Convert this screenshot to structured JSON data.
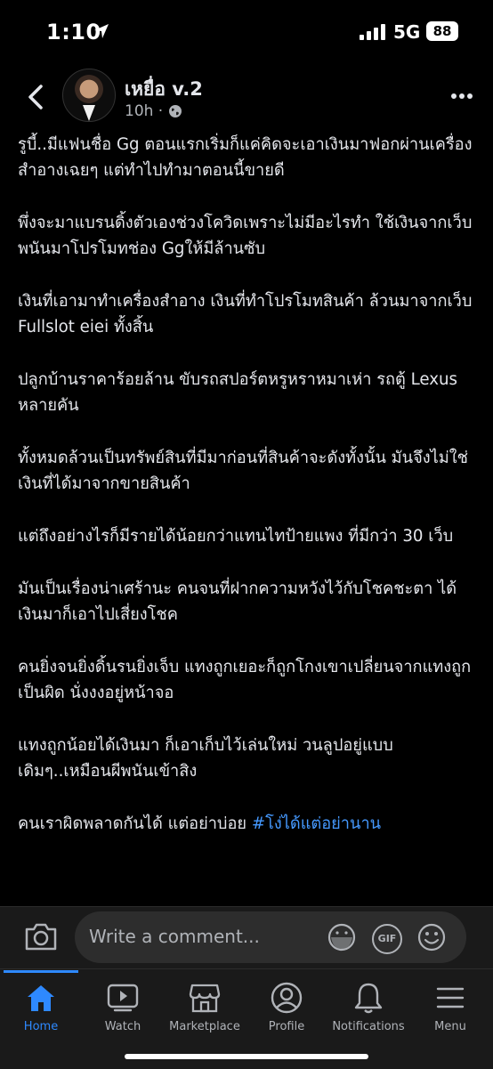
{
  "status": {
    "time": "1:10",
    "network": "5G",
    "battery": "88"
  },
  "post": {
    "author": "เหยื่อ v.2",
    "time": "10h ·",
    "paragraphs": [
      "รูบี้..มีแฟนชื่อ Gg ตอนแรกเริ่มก็แค่คิดจะเอาเงินมาฟอกผ่านเครื่องสำอางเฉยๆ แต่ทำไปทำมาตอนนี้ขายดี",
      "พึ่งจะมาแบรนดิ้งตัวเองช่วงโควิดเพราะไม่มีอะไรทำ ใช้เงินจากเว็บพนันมาโปรโมทช่อง Ggให้มีล้านซับ",
      "เงินที่เอามาทำเครื่องสำอาง เงินที่ทำโปรโมทสินค้า ล้วนมาจากเว็บ Fullslot eiei ทั้งสิ้น",
      "ปลูกบ้านราคาร้อยล้าน ขับรถสปอร์ตหรูหราหมาเห่า รถตู้ Lexus หลายคัน",
      "ทั้งหมดล้วนเป็นทรัพย์สินที่มีมาก่อนที่สินค้าจะดังทั้งนั้น มันจึงไม่ใช่เงินที่ได้มาจากขายสินค้า",
      "แต่ถึงอย่างไรก็มีรายได้น้อยกว่าแทนไทป้ายแพง ที่มีกว่า 30 เว็บ",
      "มันเป็นเรื่องน่าเศร้านะ คนจนที่ฝากความหวังไว้กับโชคชะตา ได้เงินมาก็เอาไปเสี่ยงโชค",
      "คนยิ่งจนยิ่งดิ้นรนยิ่งเจ็บ แทงถูกเยอะก็ถูกโกงเขาเปลี่ยนจากแทงถูกเป็นผิด นั่งงงอยู่หน้าจอ",
      "แทงถูกน้อยได้เงินมา ก็เอาเก็บไว้เล่นใหม่ วนลูปอยู่แบบเดิมๆ..เหมือนผีพนันเข้าสิง"
    ],
    "last_paragraph": "คนเราผิดพลาดกันได้ แต่อย่าบ่อย ",
    "hashtag": "#โง่ได้แต่อย่านาน"
  },
  "comment": {
    "placeholder": "Write a comment...",
    "gif_label": "GIF"
  },
  "nav": {
    "home": "Home",
    "watch": "Watch",
    "marketplace": "Marketplace",
    "profile": "Profile",
    "notifications": "Notifications",
    "menu": "Menu"
  },
  "colors": {
    "accent": "#2e89ff",
    "hashtag": "#4599ff",
    "background": "#000000"
  }
}
